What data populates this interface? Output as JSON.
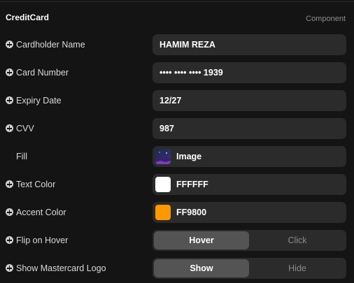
{
  "header": {
    "title": "CreditCard",
    "subtitle": "Component"
  },
  "properties": {
    "cardholder_name": {
      "label": "Cardholder Name",
      "value": "HAMIM REZA"
    },
    "card_number": {
      "label": "Card Number",
      "value": "•••• •••• •••• 1939"
    },
    "expiry_date": {
      "label": "Expiry Date",
      "value": "12/27"
    },
    "cvv": {
      "label": "CVV",
      "value": "987"
    },
    "fill": {
      "label": "Fill",
      "value": "Image"
    },
    "text_color": {
      "label": "Text Color",
      "value": "FFFFFF",
      "swatch": "#FFFFFF"
    },
    "accent_color": {
      "label": "Accent Color",
      "value": "FF9800",
      "swatch": "#FF9800"
    },
    "flip_on_hover": {
      "label": "Flip on Hover",
      "options": [
        "Hover",
        "Click"
      ],
      "selected": "Hover"
    },
    "show_mastercard_logo": {
      "label": "Show Mastercard Logo",
      "options": [
        "Show",
        "Hide"
      ],
      "selected": "Show"
    }
  },
  "icons": {
    "add_property": "plus-circle-icon",
    "fill_thumbnail": "image-thumbnail-icon"
  }
}
